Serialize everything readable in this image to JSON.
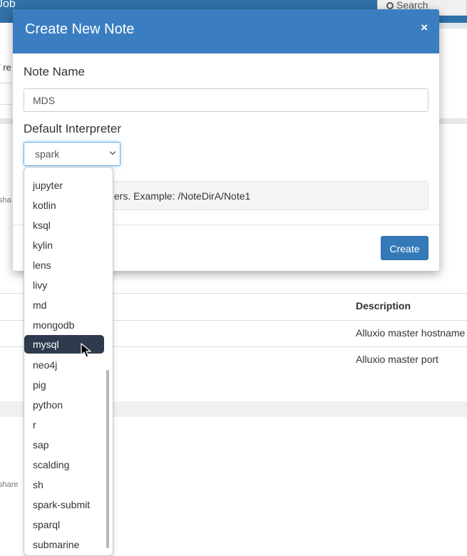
{
  "background": {
    "brand": "Job",
    "search_label": "Search",
    "fragment_re": "/ re",
    "fragment_sha_1": "sha",
    "fragment_sha_2": "share",
    "table": {
      "header_description": "Description",
      "rows": [
        "Alluxio master hostname",
        "Alluxio master port"
      ]
    }
  },
  "modal": {
    "title": "Create New Note",
    "close_symbol": "×",
    "note_name_label": "Note Name",
    "note_name_value": "MDS",
    "interpreter_label": "Default Interpreter",
    "interpreter_selected": "spark",
    "hint_text": "lders. Example: /NoteDirA/Note1",
    "create_label": "Create"
  },
  "dropdown": {
    "options": [
      "jupyter",
      "kotlin",
      "ksql",
      "kylin",
      "lens",
      "livy",
      "md",
      "mongodb",
      "mysql",
      "neo4j",
      "pig",
      "python",
      "r",
      "sap",
      "scalding",
      "sh",
      "spark-submit",
      "sparql",
      "submarine"
    ],
    "highlighted": "mysql"
  },
  "colors": {
    "header": "#3a7ec1",
    "primary_button": "#337ab7",
    "highlight": "#2e3b4e"
  },
  "icons": {
    "search": "search-icon",
    "close": "close-icon",
    "chevron": "chevron-down-icon",
    "cursor": "mouse-pointer-icon"
  }
}
